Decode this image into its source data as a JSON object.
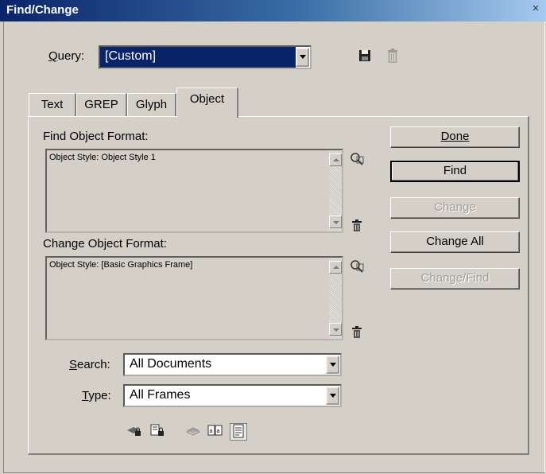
{
  "window": {
    "title": "Find/Change",
    "close_glyph": "×"
  },
  "query": {
    "label": "Query:",
    "value": "[Custom]"
  },
  "toolbar_icons": [
    "save-query-icon",
    "delete-query-icon"
  ],
  "tabs": [
    {
      "label": "Text",
      "active": false
    },
    {
      "label": "GREP",
      "active": false
    },
    {
      "label": "Glyph",
      "active": false
    },
    {
      "label": "Object",
      "active": true
    }
  ],
  "find_format": {
    "label": "Find Object Format:",
    "value": "Object Style: Object Style 1"
  },
  "change_format": {
    "label": "Change Object Format:",
    "value": "Object Style: [Basic Graphics Frame]"
  },
  "search": {
    "label": "Search:",
    "value": "All Documents"
  },
  "type": {
    "label": "Type:",
    "value": "All Frames"
  },
  "buttons": {
    "done": "Done",
    "find": "Find",
    "change": "Change",
    "change_all": "Change All",
    "change_find": "Change/Find"
  },
  "button_states": {
    "change": "disabled",
    "change_find": "disabled",
    "find": "default"
  },
  "option_icons": [
    "include-locked-layers-icon",
    "include-locked-stories-icon",
    "include-hidden-layers-icon",
    "include-master-pages-icon",
    "include-footnotes-icon"
  ]
}
